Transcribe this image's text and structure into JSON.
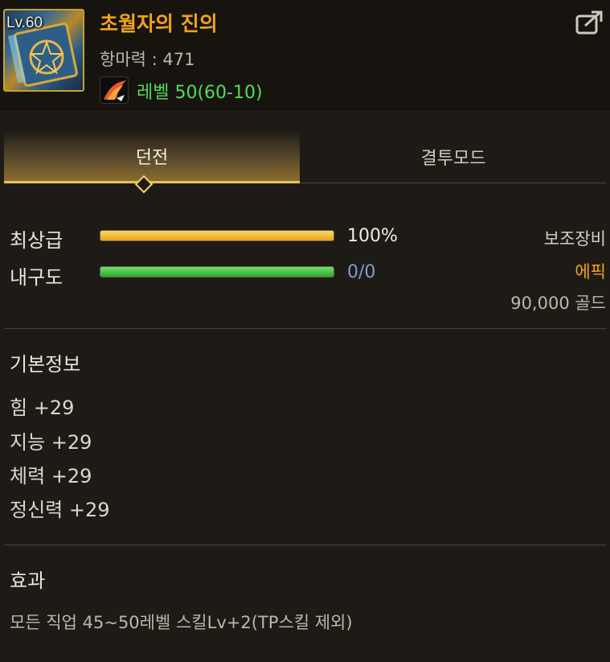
{
  "item": {
    "level_badge": "Lv.60",
    "name": "초월자의 진의",
    "stat_line": "항마력 : 471",
    "level_requirement": "레벨 50(60-10)",
    "icon": "pentagram-book-icon",
    "level_icon": "phoenix-feather-icon"
  },
  "header": {
    "share_icon": "share-icon"
  },
  "tabs": [
    {
      "label": "던전",
      "active": true
    },
    {
      "label": "결투모드",
      "active": false
    }
  ],
  "bars": {
    "grade": {
      "label": "최상급",
      "value": "100%",
      "fill": 1.0,
      "color": "#e8b02a"
    },
    "durability": {
      "label": "내구도",
      "value": "0/0",
      "fill": 1.0,
      "color": "#3fbf3c"
    }
  },
  "info": {
    "type": "보조장비",
    "rarity": "에픽",
    "rarity_color": "#f0a21c",
    "price": "90,000 골드"
  },
  "basic_info": {
    "title": "기본정보",
    "stats": [
      "힘 +29",
      "지능 +29",
      "체력 +29",
      "정신력 +29"
    ]
  },
  "effect": {
    "title": "효과",
    "text": "모든 직업 45~50레벨 스킬Lv+2(TP스킬 제외)"
  }
}
